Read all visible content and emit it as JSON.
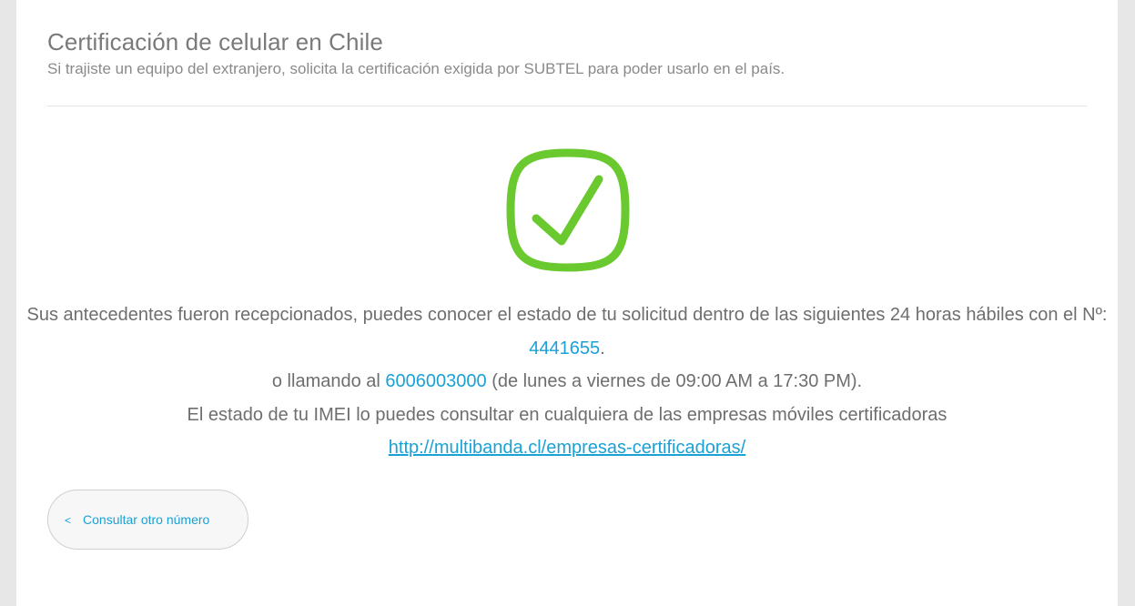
{
  "header": {
    "title": "Certificación de celular en Chile",
    "subtitle": "Si trajiste un equipo del extranjero, solicita la certificación exigida por SUBTEL para poder usarlo en el país."
  },
  "status": {
    "icon": "check-circle-icon",
    "color": "#6ac92f"
  },
  "message": {
    "line1_text": "Sus antecedentes fueron recepcionados, puedes conocer el estado de tu solicitud dentro de las siguientes 24 horas hábiles con el Nº: ",
    "request_number": "4441655",
    "line1_end": ".",
    "line2_prefix": "o llamando al ",
    "phone": "6006003000",
    "line2_suffix": " (de lunes a viernes de 09:00 AM a 17:30 PM).",
    "line3_text": "El estado de tu IMEI lo puedes consultar en cualquiera de las empresas móviles certificadoras",
    "link": "http://multibanda.cl/empresas-certificadoras/"
  },
  "back_button": {
    "chevron": "<",
    "label": "Consultar otro número"
  },
  "colors": {
    "accent": "#1aa1d6",
    "success": "#6ac92f"
  }
}
